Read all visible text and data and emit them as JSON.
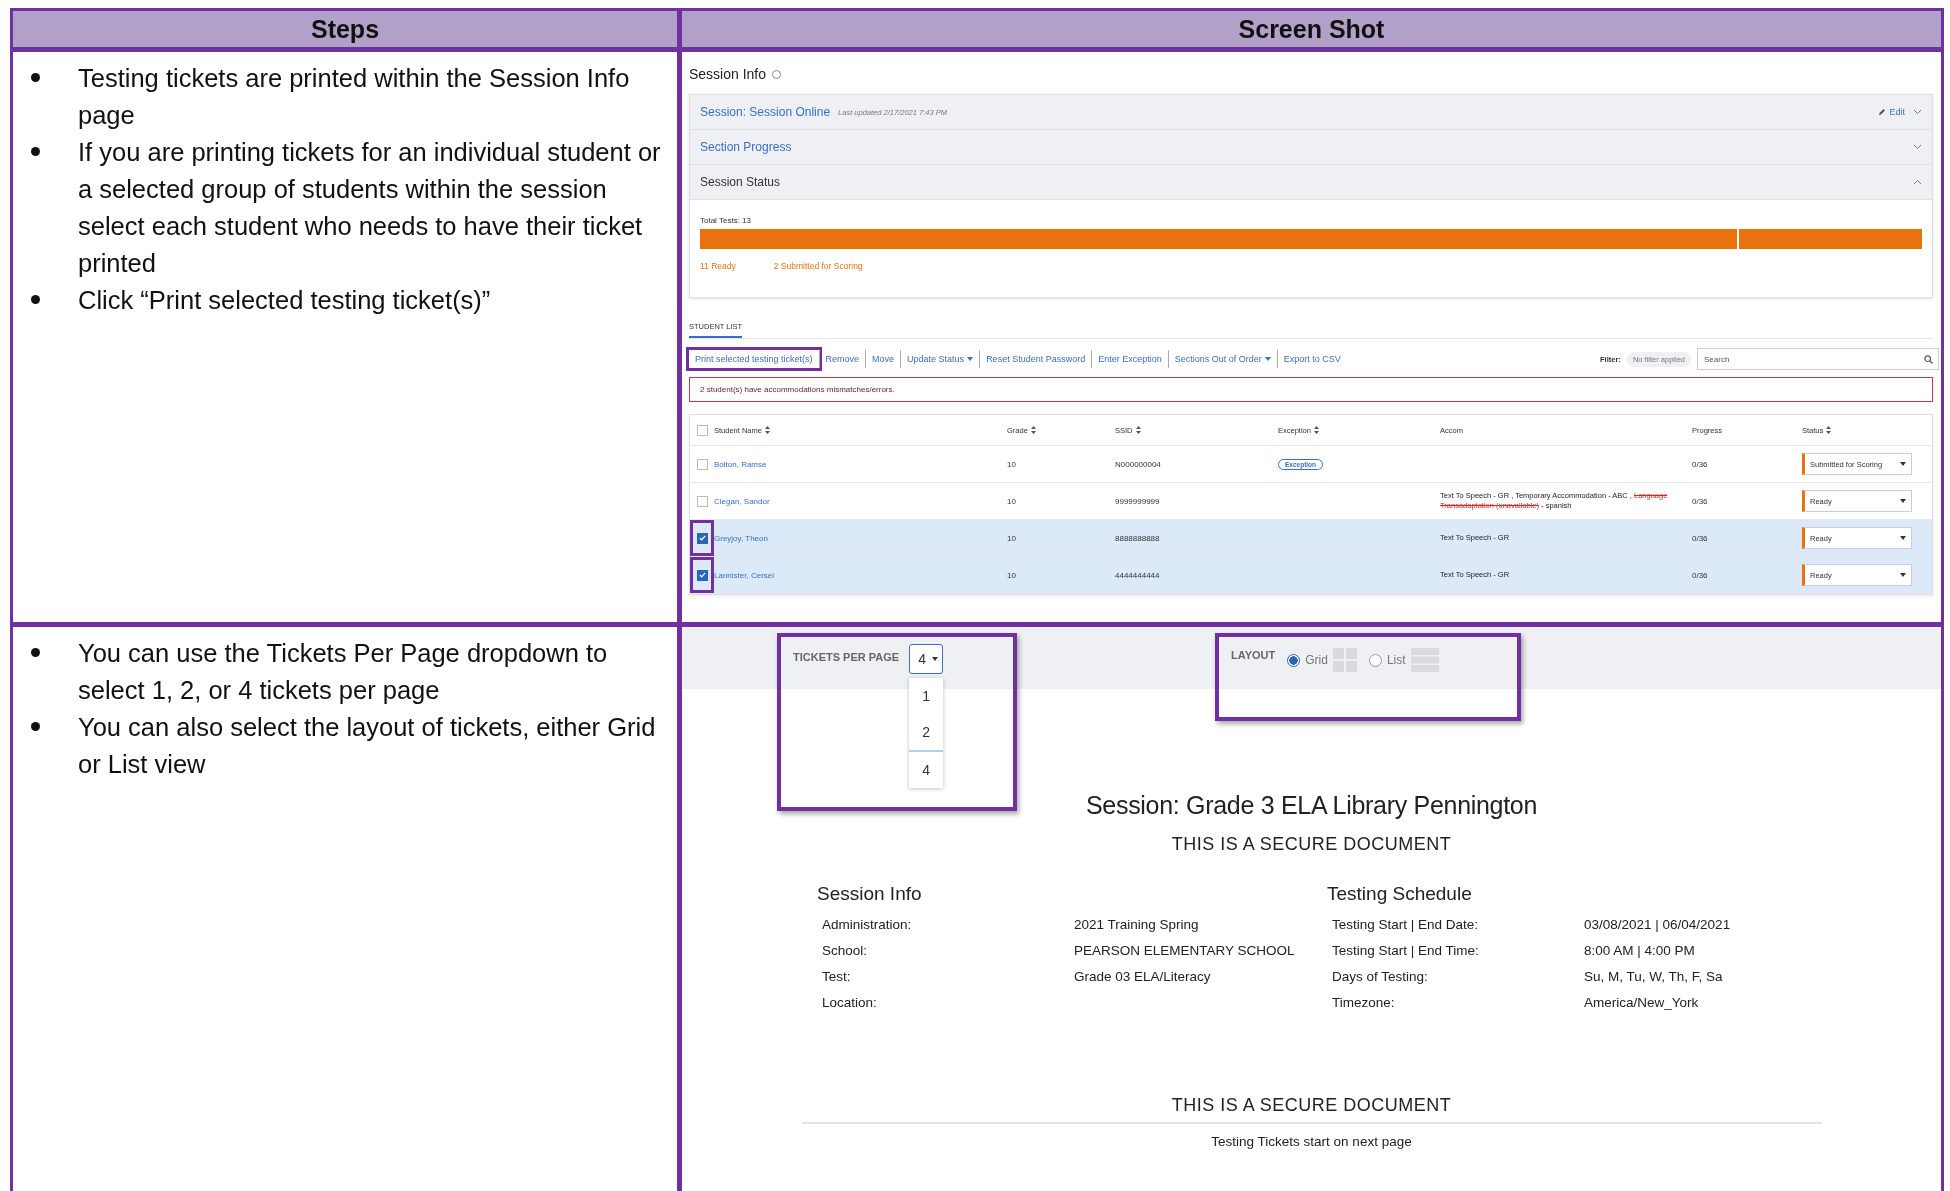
{
  "header": {
    "steps": "Steps",
    "screenshot": "Screen Shot"
  },
  "row_1": {
    "steps": [
      "Testing tickets are printed within the Session Info page",
      "If you are printing tickets for an individual student or a selected group of students within the session select each student who needs to have their ticket printed",
      "Click “Print selected testing ticket(s)”"
    ],
    "session_info": {
      "title": "Session Info",
      "panels": [
        {
          "kind": "link",
          "title": "Session: Session Online",
          "subtitle": "Last updated 2/17/2021 7:43 PM",
          "edit": "Edit",
          "expanded": false
        },
        {
          "kind": "link",
          "title": "Section Progress",
          "expanded": false
        },
        {
          "kind": "plain",
          "title": "Session Status",
          "expanded": true
        }
      ],
      "status": {
        "total": "Total Tests: 13",
        "level": 0.85,
        "legend": [
          "11 Ready",
          "2 Submitted for Scoring"
        ]
      },
      "select_all_checked": false,
      "list_tab": "STUDENT LIST",
      "actions": [
        {
          "label": "Print selected testing ticket(s)",
          "dropdown": false,
          "highlighted": true
        },
        {
          "label": "Remove",
          "dropdown": false,
          "highlighted": false
        },
        {
          "label": "Move",
          "dropdown": false,
          "highlighted": false
        },
        {
          "label": "Update Status",
          "dropdown": true,
          "highlighted": false
        },
        {
          "label": "Reset Student Password",
          "dropdown": false,
          "highlighted": false
        },
        {
          "label": "Enter Exception",
          "dropdown": false,
          "highlighted": false
        },
        {
          "label": "Sections Out of Order",
          "dropdown": true,
          "highlighted": false
        },
        {
          "label": "Export to CSV",
          "dropdown": false,
          "highlighted": false
        }
      ],
      "filter": {
        "label": "Filter:",
        "value": "No filter applied"
      },
      "search": {
        "placeholder": "Search"
      },
      "alert": "2 student(s) have accommodations mismatches/errors.",
      "columns": [
        {
          "label": "Student Name",
          "sortable": true
        },
        {
          "label": "Grade",
          "sortable": true
        },
        {
          "label": "SSID",
          "sortable": true
        },
        {
          "label": "Exception",
          "sortable": true
        },
        {
          "label": "Accom",
          "sortable": false
        },
        {
          "label": "Progress",
          "sortable": false
        },
        {
          "label": "Status",
          "sortable": true
        }
      ],
      "rows": [
        {
          "name": "Bolton, Ramse",
          "grade": "10",
          "ssid": "N000000004",
          "exception": "Exception",
          "accom": [],
          "progress": "0/36",
          "status": "Submitted for Scoring",
          "checked": false,
          "highlighted": false
        },
        {
          "name": "Clegan, Sandor",
          "grade": "10",
          "ssid": "9999999999",
          "accom": [
            {
              "text": "Text To Speech - GR , Temporary Accommodation - ABC ,",
              "unavailable": false
            },
            {
              "text": "Language Transadaptation (unavailable)",
              "unavailable": true
            },
            {
              "text": "- spanish",
              "unavailable": false
            }
          ],
          "progress": "0/36",
          "status": "Ready",
          "checked": false,
          "highlighted": false
        },
        {
          "name": "Greyjoy, Theon",
          "grade": "10",
          "ssid": "8888888888",
          "accom": [
            {
              "text": "Text To Speech - GR",
              "unavailable": false
            }
          ],
          "progress": "0/36",
          "status": "Ready",
          "checked": true,
          "highlighted": true
        },
        {
          "name": "Lannister, Cersei",
          "grade": "10",
          "ssid": "4444444444",
          "accom": [
            {
              "text": "Text To Speech - GR",
              "unavailable": false
            }
          ],
          "progress": "0/36",
          "status": "Ready",
          "checked": true,
          "highlighted": true
        }
      ]
    }
  },
  "row_2": {
    "steps": [
      "You can use the Tickets Per Page dropdown to select 1, 2, or 4 tickets per page",
      "You can also select the layout of tickets, either Grid or List view"
    ],
    "ticket_setup": {
      "tickets_per_page": {
        "label": "TICKETS PER PAGE",
        "value": "4",
        "options": [
          {
            "label": "1",
            "selected": false
          },
          {
            "label": "2",
            "selected": false
          },
          {
            "label": "4",
            "selected": true
          }
        ]
      },
      "layout": {
        "label": "LAYOUT",
        "options": [
          {
            "kind": "grid",
            "label": "Grid",
            "selected": true
          },
          {
            "kind": "list",
            "label": "List",
            "selected": false
          }
        ]
      },
      "document": {
        "title": "Session: Grade 3 ELA Library Pennington",
        "notice": "THIS IS A SECURE DOCUMENT",
        "sections": [
          {
            "heading": "Session Info",
            "fields": [
              {
                "label": "Administration:",
                "value": "2021 Training Spring"
              },
              {
                "label": "School:",
                "value": "PEARSON ELEMENTARY SCHOOL"
              },
              {
                "label": "Test:",
                "value": "Grade 03 ELA/Literacy"
              },
              {
                "label": "Location:"
              }
            ]
          },
          {
            "heading": "Testing Schedule",
            "fields": [
              {
                "label": "Testing Start | End Date:",
                "value": "03/08/2021 | 06/04/2021"
              },
              {
                "label": "Testing Start | End Time:",
                "value": "8:00 AM | 4:00 PM"
              },
              {
                "label": "Days of Testing:",
                "value": "Su, M, Tu, W, Th, F, Sa"
              },
              {
                "label": "Timezone:",
                "value": "America/New_York"
              }
            ]
          }
        ],
        "footer_notice": "THIS IS A SECURE DOCUMENT",
        "footer_note": "Testing Tickets start on next page"
      }
    }
  }
}
